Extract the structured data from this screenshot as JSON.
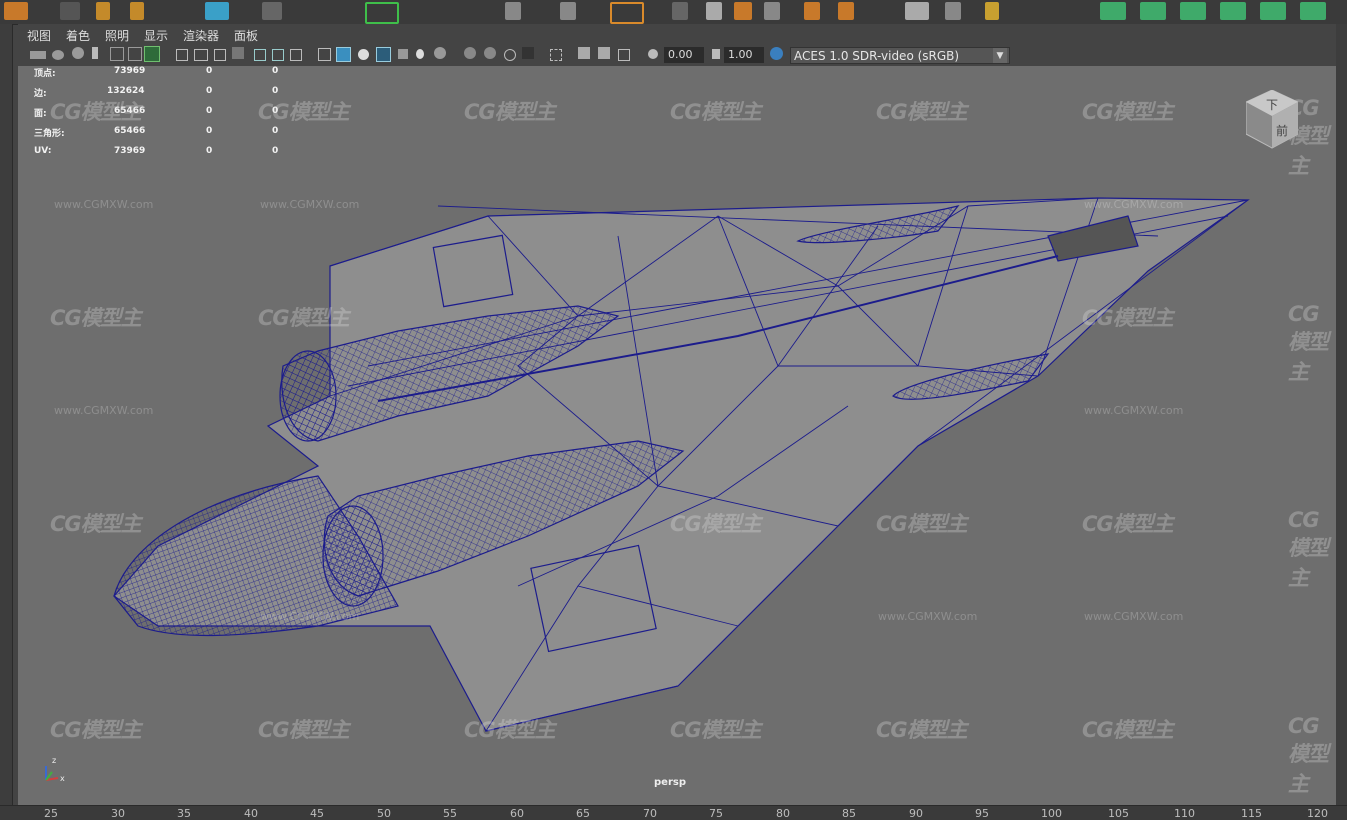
{
  "menu": [
    "视图",
    "着色",
    "照明",
    "显示",
    "渲染器",
    "面板"
  ],
  "toolbar": {
    "exposure": "0.00",
    "gamma": "1.00",
    "color_space": "ACES 1.0 SDR-video (sRGB)"
  },
  "stats": {
    "rows": [
      {
        "label": "顶点:",
        "v1": "73969",
        "v2": "0",
        "v3": "0"
      },
      {
        "label": "边:",
        "v1": "132624",
        "v2": "0",
        "v3": "0"
      },
      {
        "label": "面:",
        "v1": "65466",
        "v2": "0",
        "v3": "0"
      },
      {
        "label": "三角形:",
        "v1": "65466",
        "v2": "0",
        "v3": "0"
      },
      {
        "label": "UV:",
        "v1": "73969",
        "v2": "0",
        "v3": "0"
      }
    ]
  },
  "viewport": {
    "camera_label": "persp",
    "viewcube_labels": [
      "下",
      "前"
    ],
    "axis_labels": [
      "z",
      "x"
    ]
  },
  "watermark": {
    "logo": "CG模型主",
    "url": "www.CGMXW.com"
  },
  "ruler": [
    "25",
    "30",
    "35",
    "40",
    "45",
    "50",
    "55",
    "60",
    "65",
    "70",
    "75",
    "80",
    "85",
    "90",
    "95",
    "100",
    "105",
    "110",
    "115",
    "120"
  ],
  "colors": {
    "viewport_bg": "#6e6e6e",
    "wireframe": "#1c1c8c",
    "mesh_fill": "#8e8e8e",
    "panel_bg": "#444444"
  }
}
